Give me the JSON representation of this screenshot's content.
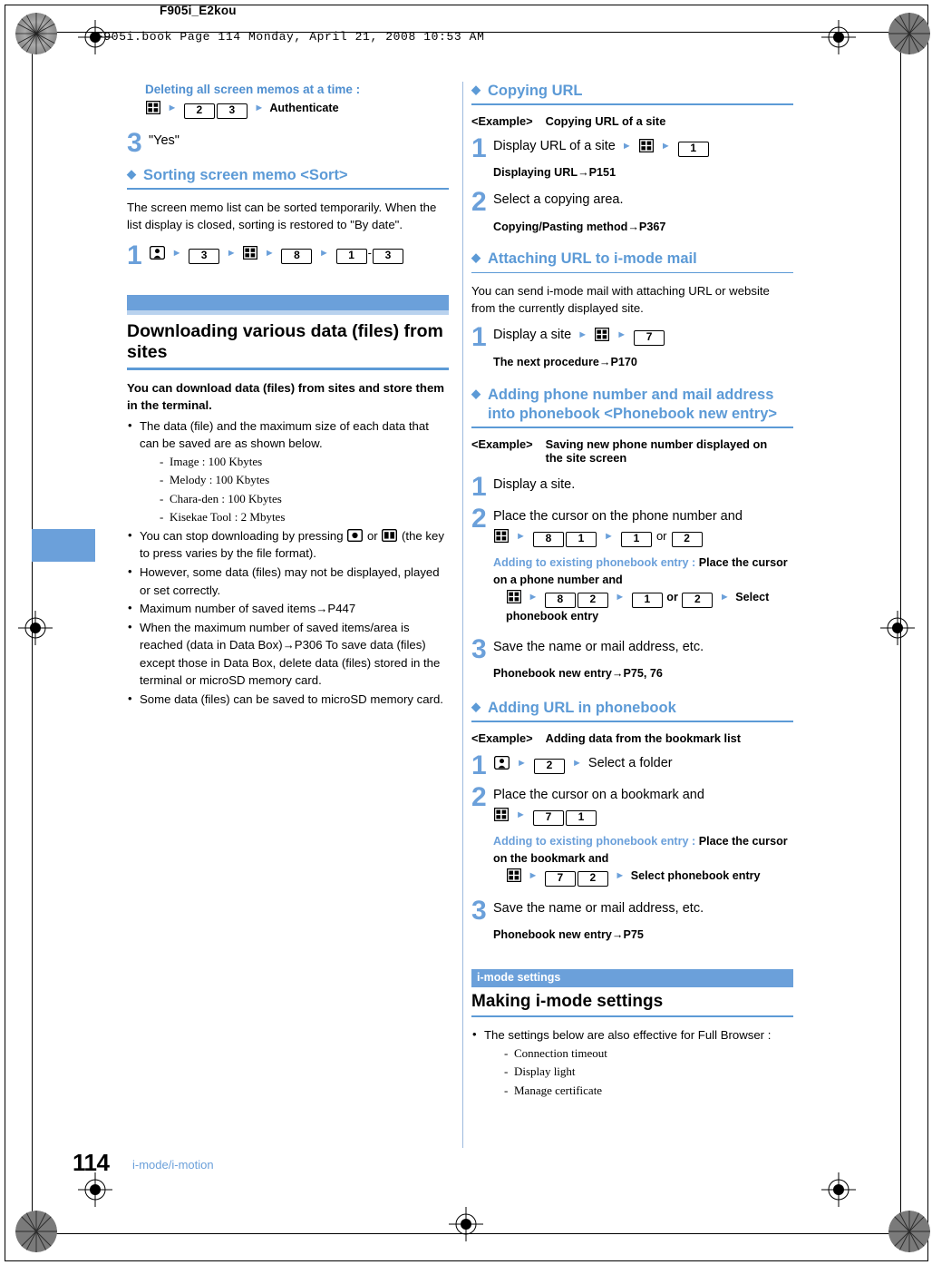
{
  "document": {
    "header_label": "F905i_E2kou",
    "book_line": "F905i.book  Page 114  Monday, April 21, 2008  10:53 AM",
    "page_number": "114",
    "page_section": "i-mode/i-motion"
  },
  "colors": {
    "accent_blue": "#6ba0da",
    "rule_blue": "#5c9ad6",
    "light_blue": "#b9d2ee",
    "heading_blue": "#4f8fd0"
  },
  "left_column": {
    "carryover_note": {
      "title": "Deleting all screen memos at a time :",
      "keys": [
        "menu-key",
        "arrow",
        "key-2",
        "key-3",
        "arrow",
        "Authenticate"
      ]
    },
    "step_yes": {
      "num": "3",
      "text": "\"Yes\""
    },
    "sorting_heading": "Sorting screen memo <Sort>",
    "sorting_body": "The screen memo list can be sorted temporarily. When the list display is closed, sorting is restored to \"By date\".",
    "sorting_step": {
      "num": "1",
      "keys": [
        "imode-key",
        "arrow",
        "key-3",
        "arrow",
        "menu-key",
        "arrow",
        "key-8",
        "arrow",
        "key-1",
        "-",
        "key-3"
      ]
    },
    "chapter": {
      "title": "Downloading various data (files) from sites",
      "intro": "You can download data (files) from sites and store them in the terminal.",
      "bullets": [
        {
          "text": "The data (file) and the maximum size of each data that can be saved are as shown below.",
          "sub": [
            "Image : 100 Kbytes",
            "Melody : 100 Kbytes",
            "Chara-den : 100 Kbytes",
            "Kisekae Tool : 2 Mbytes"
          ]
        },
        {
          "text_before": "You can stop downloading by pressing",
          "icon_a": "center-select-key",
          "mid": "or",
          "icon_b": "book-key",
          "text_after": "(the key to press varies by the file format).",
          "sub": []
        },
        {
          "text": "However, some data (files) may not be displayed, played or set correctly.",
          "sub": []
        },
        {
          "text": "Maximum number of saved items→P447",
          "sub": []
        },
        {
          "text": "When the maximum number of saved items/area is reached (data in Data Box)→P306 To save data (files) except those in Data Box, delete data (files) stored in the terminal or microSD memory card.",
          "sub": []
        },
        {
          "text": "Some data (files) can be saved to microSD memory card.",
          "sub": []
        }
      ]
    }
  },
  "right_column": {
    "copying_url": {
      "heading": "Copying URL",
      "example_label": "<Example>",
      "example_text": "Copying URL of a site",
      "step1": {
        "num": "1",
        "text": "Display URL of a site",
        "keys": [
          "arrow",
          "menu-key",
          "arrow",
          "key-1"
        ],
        "note": "Displaying URL→P151"
      },
      "step2": {
        "num": "2",
        "text": "Select a copying area.",
        "note": "Copying/Pasting method→P367"
      }
    },
    "attaching_url": {
      "heading": "Attaching URL to i-mode mail",
      "body": "You can send i-mode mail with attaching URL or website from the currently displayed site.",
      "step1": {
        "num": "1",
        "text": "Display a site",
        "keys": [
          "arrow",
          "menu-key",
          "arrow",
          "key-7"
        ],
        "note": "The next procedure→P170"
      }
    },
    "adding_phone": {
      "heading_line1": "Adding phone number and mail address",
      "heading_line2": "into phonebook <Phonebook new entry>",
      "example_label": "<Example>",
      "example_line1": "Saving new phone number displayed on",
      "example_line2": "the site screen",
      "step1": {
        "num": "1",
        "text": "Display a site."
      },
      "step2": {
        "num": "2",
        "text": "Place the cursor on the phone number and",
        "keys": [
          "menu-key",
          "arrow",
          "key-8",
          "key-1",
          "arrow",
          "key-1",
          "or",
          "key-2"
        ],
        "sub_label": "Adding to existing phonebook entry :",
        "sub_text1": "Place the cursor on a phone number and",
        "sub_keys": [
          "menu-key",
          "arrow",
          "key-8",
          "key-2",
          "arrow",
          "key-1",
          "or",
          "key-2",
          "arrow",
          "Select phonebook entry"
        ]
      },
      "step3": {
        "num": "3",
        "text": "Save the name or mail address, etc.",
        "note": "Phonebook new entry→P75, 76"
      }
    },
    "adding_url_phonebook": {
      "heading": "Adding URL in phonebook",
      "example_label": "<Example>",
      "example_text": "Adding data from the bookmark list",
      "step1": {
        "num": "1",
        "keys": [
          "imode-key",
          "arrow",
          "key-2",
          "arrow"
        ],
        "text": "Select a folder"
      },
      "step2": {
        "num": "2",
        "text": "Place the cursor on a bookmark and",
        "keys": [
          "menu-key",
          "arrow",
          "key-7",
          "key-1"
        ],
        "sub_label": "Adding to existing phonebook entry :",
        "sub_text1": "Place the cursor on the bookmark and",
        "sub_keys": [
          "menu-key",
          "arrow",
          "key-7",
          "key-2",
          "arrow",
          "Select phonebook entry"
        ]
      },
      "step3": {
        "num": "3",
        "text": "Save the name or mail address, etc.",
        "note": "Phonebook new entry→P75"
      }
    },
    "imode_settings": {
      "tag": "i-mode settings",
      "title": "Making i-mode settings",
      "bullet": "The settings below are also effective for Full Browser :",
      "sub": [
        "Connection timeout",
        "Display light",
        "Manage certificate"
      ]
    }
  }
}
